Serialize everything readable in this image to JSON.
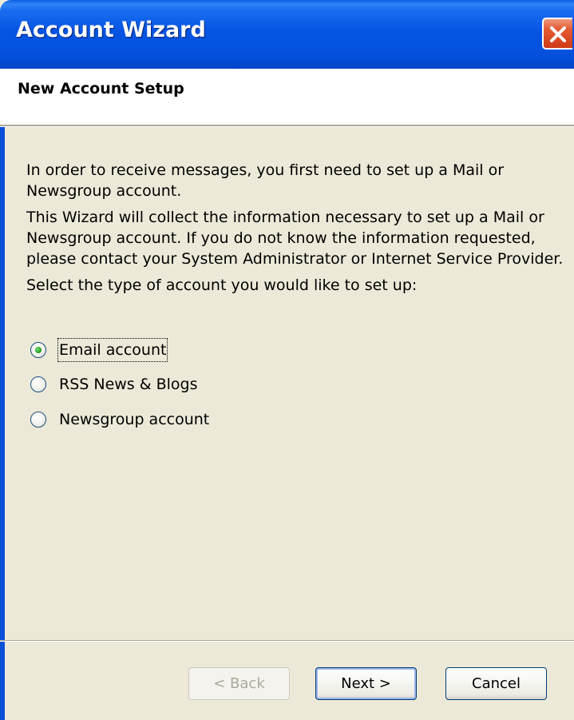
{
  "window": {
    "title": "Account Wizard"
  },
  "header": {
    "title": "New Account Setup"
  },
  "body": {
    "lines": [
      "In order to receive messages, you first need to set up a Mail or",
      "Newsgroup account.",
      "This Wizard will collect the information necessary to set up a Mail or",
      "Newsgroup account. If you do not know the information requested,",
      "please contact your System Administrator or Internet Service Provider.",
      "Select the type of account you would like to set up:"
    ]
  },
  "options": [
    {
      "label": "Email account",
      "selected": true
    },
    {
      "label": "RSS News & Blogs",
      "selected": false
    },
    {
      "label": "Newsgroup account",
      "selected": false
    }
  ],
  "buttons": {
    "back": "< Back",
    "next": "Next >",
    "cancel": "Cancel"
  },
  "colors": {
    "titlebar": "#0554e3",
    "dialog_bg": "#ece9d8",
    "close_button": "#e45a33",
    "radio_selected_dot": "#21a121"
  },
  "icons": {
    "close": "close-icon"
  }
}
